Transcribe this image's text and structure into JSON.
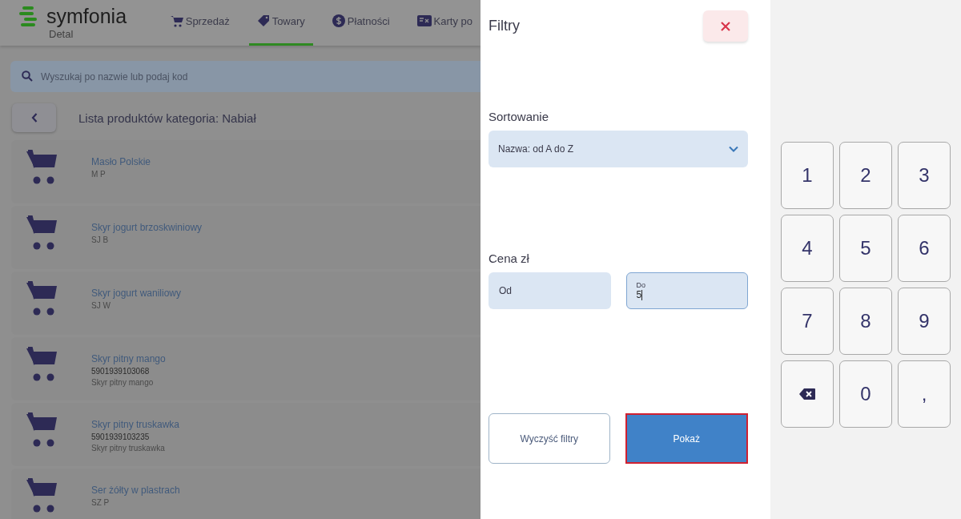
{
  "header": {
    "logo": {
      "name": "symfonia",
      "subtitle": "Detal"
    },
    "tabs": [
      {
        "label": "Sprzedaż",
        "kind": "cart",
        "selected": false
      },
      {
        "label": "Towary",
        "kind": "tag",
        "selected": true
      },
      {
        "label": "Płatności",
        "kind": "dollar",
        "selected": false
      },
      {
        "label": "Karty po",
        "kind": "card",
        "selected": false
      }
    ]
  },
  "search": {
    "placeholder": "Wyszukaj po nazwie lub podaj kod"
  },
  "category": {
    "title": "Lista produktów kategoria: Nabiał"
  },
  "products": [
    {
      "name": "Masło Polskie",
      "code": "M P"
    },
    {
      "name": "Skyr jogurt brzoskwiniowy",
      "code": "SJ B"
    },
    {
      "name": "Skyr jogurt waniliowy",
      "code": "SJ W"
    },
    {
      "name": "Skyr pitny mango",
      "barcode": "5901939103068",
      "code": "Skyr pitny mango"
    },
    {
      "name": "Skyr pitny truskawka",
      "barcode": "5901939103235",
      "code": "Skyr pitny truskawka"
    },
    {
      "name": "Ser żółty w plastrach",
      "code": "SZ P"
    }
  ],
  "filters": {
    "title": "Filtry",
    "sort": {
      "label": "Sortowanie",
      "value": "Nazwa: od A do Z"
    },
    "price": {
      "label": "Cena zł",
      "from": {
        "placeholder": "Od"
      },
      "to": {
        "label": "Do",
        "value": "5",
        "focused": true
      }
    },
    "buttons": [
      {
        "label": "Wyczyść filtry",
        "kind": "outline",
        "focused": false
      },
      {
        "label": "Pokaż",
        "kind": "primary",
        "focused": true
      }
    ]
  },
  "keypad": [
    {
      "kind": "digit",
      "label": "1"
    },
    {
      "kind": "digit",
      "label": "2"
    },
    {
      "kind": "digit",
      "label": "3"
    },
    {
      "kind": "digit",
      "label": "4"
    },
    {
      "kind": "digit",
      "label": "5"
    },
    {
      "kind": "digit",
      "label": "6"
    },
    {
      "kind": "digit",
      "label": "7"
    },
    {
      "kind": "digit",
      "label": "8"
    },
    {
      "kind": "digit",
      "label": "9"
    },
    {
      "kind": "backspace"
    },
    {
      "kind": "digit",
      "label": "0"
    },
    {
      "kind": "digit",
      "label": ","
    }
  ]
}
